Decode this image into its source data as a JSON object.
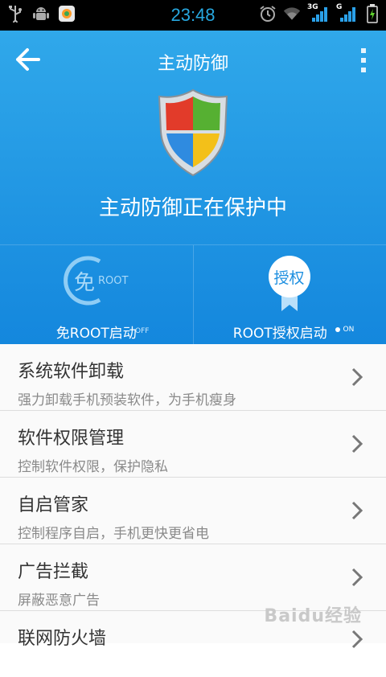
{
  "status_bar": {
    "time": "23:48",
    "icons": [
      "usb-icon",
      "android-debug-icon",
      "app-icon",
      "alarm-icon",
      "wifi-icon",
      "3g-signal-icon",
      "g-signal-icon",
      "battery-icon"
    ],
    "net_3g": "3G",
    "net_g": "G"
  },
  "header": {
    "title": "主动防御",
    "status": "主动防御正在保护中"
  },
  "panels": [
    {
      "label": "免ROOT启动",
      "icon_main": "免",
      "icon_sub": "ROOT",
      "toggle": "OFF"
    },
    {
      "label": "ROOT授权启动",
      "icon_text": "授权",
      "toggle": "ON"
    }
  ],
  "list": [
    {
      "title": "系统软件卸载",
      "subtitle": "强力卸载手机预装软件，为手机瘦身"
    },
    {
      "title": "软件权限管理",
      "subtitle": "控制软件权限，保护隐私"
    },
    {
      "title": "自启管家",
      "subtitle": "控制程序自启，手机更快更省电"
    },
    {
      "title": "广告拦截",
      "subtitle": "屏蔽恶意广告"
    },
    {
      "title": "联网防火墙",
      "subtitle": ""
    }
  ],
  "watermark": "Baidu经验",
  "colors": {
    "header_top": "#30a8ea",
    "header_bottom": "#1487dd",
    "time": "#27a8e0"
  }
}
